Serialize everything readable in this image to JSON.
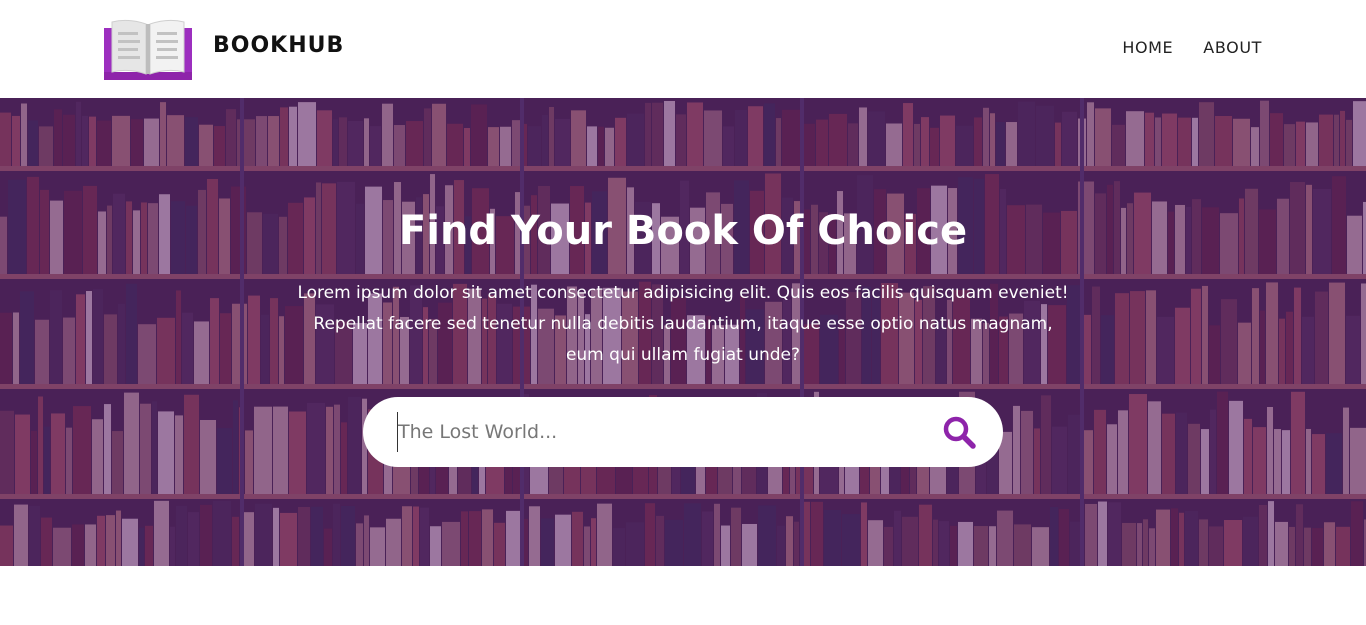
{
  "header": {
    "brand": "BOOKHUB",
    "logo_icon": "open-book-icon",
    "nav": [
      {
        "label": "HOME"
      },
      {
        "label": "ABOUT"
      }
    ]
  },
  "hero": {
    "title": "Find Your Book Of Choice",
    "description": "Lorem ipsum dolor sit amet consectetur adipisicing elit. Quis eos facilis quisquam eveniet! Repellat facere sed tenetur nulla debitis laudantium, itaque esse optio natus magnam, eum qui ullam fugiat unde?",
    "background": "bookshelf-image",
    "overlay_color": "#5a2278"
  },
  "search": {
    "placeholder": "The Lost World...",
    "value": "",
    "icon": "search-icon",
    "icon_color": "#8e24aa"
  },
  "colors": {
    "accent": "#8e24aa",
    "header_bg": "#ffffff",
    "text_dark": "#111111"
  }
}
